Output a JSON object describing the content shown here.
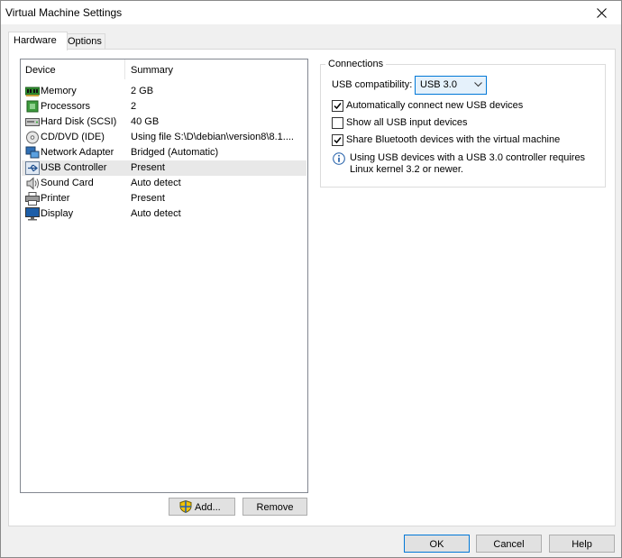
{
  "window": {
    "title": "Virtual Machine Settings"
  },
  "tabs": [
    {
      "label": "Hardware",
      "active": true
    },
    {
      "label": "Options",
      "active": false
    }
  ],
  "device_list": {
    "headers": {
      "device": "Device",
      "summary": "Summary"
    },
    "rows": [
      {
        "icon": "memory-icon",
        "device": "Memory",
        "summary": "2 GB"
      },
      {
        "icon": "processor-icon",
        "device": "Processors",
        "summary": "2"
      },
      {
        "icon": "hard-disk-icon",
        "device": "Hard Disk (SCSI)",
        "summary": "40 GB"
      },
      {
        "icon": "cd-dvd-icon",
        "device": "CD/DVD (IDE)",
        "summary": "Using file S:\\D\\debian\\version8\\8.1...."
      },
      {
        "icon": "network-adapter-icon",
        "device": "Network Adapter",
        "summary": "Bridged (Automatic)"
      },
      {
        "icon": "usb-icon",
        "device": "USB Controller",
        "summary": "Present",
        "selected": true
      },
      {
        "icon": "sound-card-icon",
        "device": "Sound Card",
        "summary": "Auto detect"
      },
      {
        "icon": "printer-icon",
        "device": "Printer",
        "summary": "Present"
      },
      {
        "icon": "display-icon",
        "device": "Display",
        "summary": "Auto detect"
      }
    ]
  },
  "list_buttons": {
    "add": "Add...",
    "remove": "Remove"
  },
  "connections": {
    "legend": "Connections",
    "usb_compat_label": "USB compatibility:",
    "usb_compat_value": "USB 3.0",
    "auto_connect": {
      "label": "Automatically connect new USB devices",
      "checked": true
    },
    "show_all": {
      "label": "Show all USB input devices",
      "checked": false
    },
    "share_bluetooth": {
      "label": "Share Bluetooth devices with the virtual machine",
      "checked": true
    },
    "info_line1": "Using USB devices with a USB 3.0 controller requires",
    "info_line2": "Linux kernel 3.2 or newer."
  },
  "dialog_buttons": {
    "ok": "OK",
    "cancel": "Cancel",
    "help": "Help"
  },
  "colors": {
    "accent": "#0078d7",
    "selected_row": "#e8e8e8",
    "select_bg": "#e5f1fb"
  }
}
